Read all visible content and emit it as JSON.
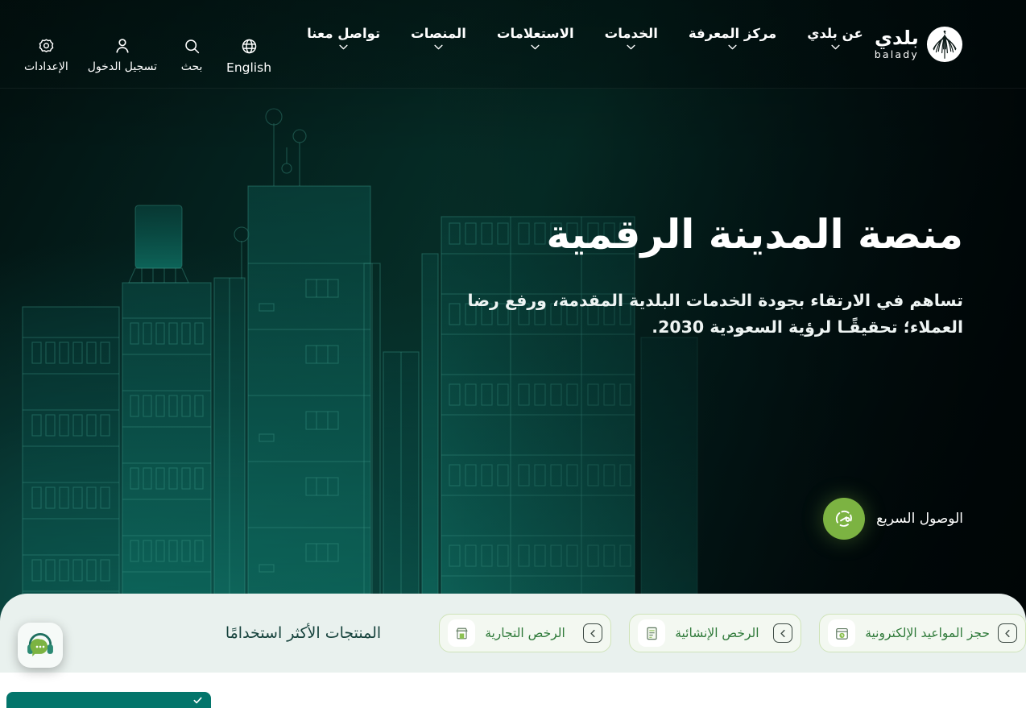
{
  "meta": {
    "language": "ar",
    "direction": "rtl"
  },
  "colors": {
    "hero_dark": "#02100f",
    "hero_teal": "#063029",
    "accent_green": "#7cb342",
    "card_bg": "#e9f1ee",
    "chip_bg": "#f3f8f1",
    "chip_border": "#cfe3b9",
    "chip_text": "#2f7a3a",
    "card_title_text": "#16423c",
    "cookie_bar": "#03756b",
    "nav_text": "#ffffff"
  },
  "navbar": {
    "brand": {
      "name_ar": "بلدي",
      "name_en": "balady",
      "logo_icon": "palm-emblem-icon"
    },
    "links": [
      {
        "label": "عن بلدي",
        "icon": "chevron-down-icon",
        "has_dropdown": true
      },
      {
        "label": "مركز المعرفة",
        "icon": "chevron-down-icon",
        "has_dropdown": true
      },
      {
        "label": "الخدمات",
        "icon": "chevron-down-icon",
        "has_dropdown": true
      },
      {
        "label": "الاستعلامات",
        "icon": "chevron-down-icon",
        "has_dropdown": true
      },
      {
        "label": "المنصات",
        "icon": "chevron-down-icon",
        "has_dropdown": true
      },
      {
        "label": "تواصل معنا",
        "icon": "chevron-down-icon",
        "has_dropdown": true
      }
    ],
    "tools": [
      {
        "label": "English",
        "icon": "globe-icon"
      },
      {
        "label": "بحث",
        "icon": "search-icon"
      },
      {
        "label": "تسجيل الدخول",
        "icon": "user-icon"
      },
      {
        "label": "الإعدادات",
        "icon": "gear-icon"
      }
    ]
  },
  "hero": {
    "title": "منصة المدينة الرقمية",
    "subtitle": "تساهم في الارتقاء بجودة الخدمات البلدية المقدمة، ورفع رضا العملاء؛ تحقيقًـا لرؤية السعودية 2030.",
    "quick_access": {
      "label": "الوصول السريع",
      "icon": "speedometer-icon"
    }
  },
  "most_used": {
    "title": "المنتجات الأكثر استخدامًا",
    "chips": [
      {
        "label": "الرخص التجارية",
        "icon": "commercial-license-icon",
        "go_icon": "chevron-left-icon"
      },
      {
        "label": "الرخص الإنشائية",
        "icon": "construction-license-icon",
        "go_icon": "chevron-left-icon"
      },
      {
        "label": "حجز المواعيد الإلكترونية",
        "icon": "appointment-booking-icon",
        "go_icon": "chevron-left-icon"
      }
    ]
  },
  "support_widget": {
    "icon": "headset-chat-icon",
    "label": "الدعم الفني"
  },
  "cookie_bar": {
    "icon": "check-icon",
    "label": ""
  }
}
